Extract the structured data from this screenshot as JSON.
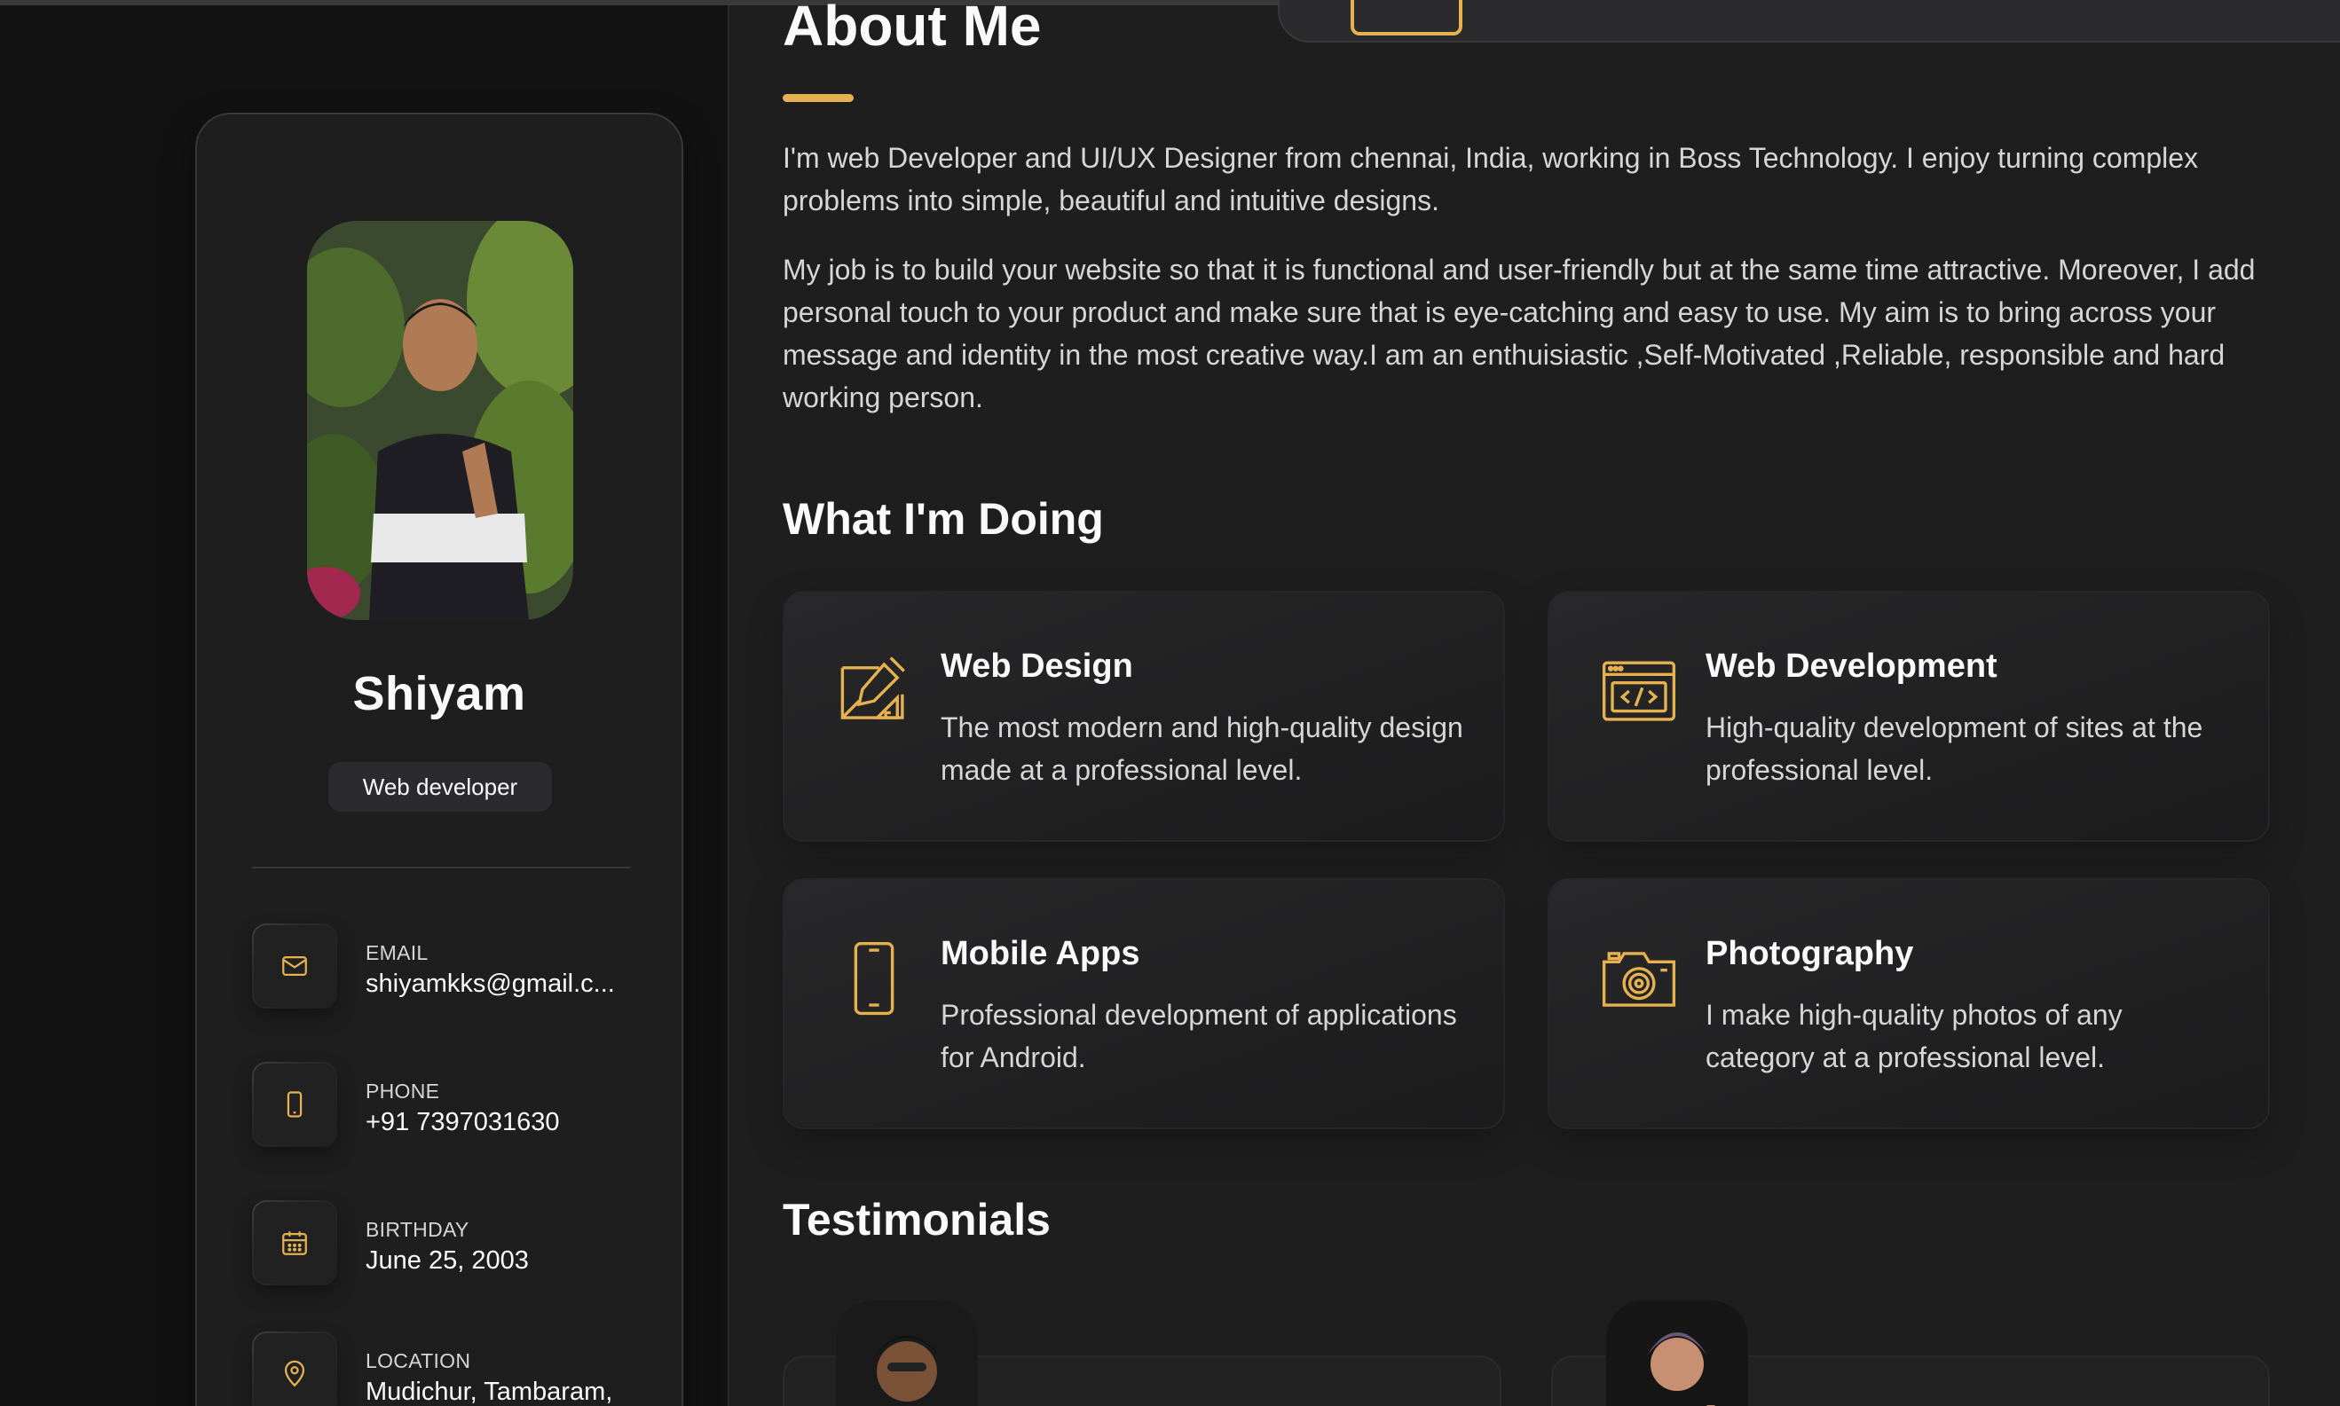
{
  "profile": {
    "name": "Shiyam",
    "title": "Web developer"
  },
  "contacts": [
    {
      "label": "Email",
      "value": "shiyamkks@gmail.c...",
      "icon": "mail-icon"
    },
    {
      "label": "Phone",
      "value": "+91 7397031630",
      "icon": "phone-icon"
    },
    {
      "label": "Birthday",
      "value": "June 25, 2003",
      "icon": "calendar-icon"
    },
    {
      "label": "Location",
      "value": "Mudichur, Tambaram,",
      "icon": "location-pin-icon"
    }
  ],
  "about": {
    "title": "About Me",
    "paragraphs": [
      "I'm web Developer and UI/UX Designer from chennai, India, working in Boss Technology. I enjoy turning complex problems into simple, beautiful and intuitive designs.",
      "My job is to build your website so that it is functional and user-friendly but at the same time attractive. Moreover, I add personal touch to your product and make sure that is eye-catching and easy to use. My aim is to bring across your message and identity in the most creative way.I am an enthuisiastic ,Self-Motivated ,Reliable, responsible and hard working person."
    ]
  },
  "doing": {
    "title": "What I'm Doing",
    "services": [
      {
        "title": "Web Design",
        "text": "The most modern and high-quality design made at a professional level.",
        "icon": "design-icon"
      },
      {
        "title": "Web Development",
        "text": "High-quality development of sites at the professional level.",
        "icon": "code-icon"
      },
      {
        "title": "Mobile Apps",
        "text": "Professional development of applications for Android.",
        "icon": "mobile-icon"
      },
      {
        "title": "Photography",
        "text": "I make high-quality photos of any category at a professional level.",
        "icon": "camera-icon"
      }
    ]
  },
  "testimonials": {
    "title": "Testimonials"
  },
  "colors": {
    "accent": "#e6b14f",
    "background": "#121212",
    "panel": "#1e1e1f"
  }
}
